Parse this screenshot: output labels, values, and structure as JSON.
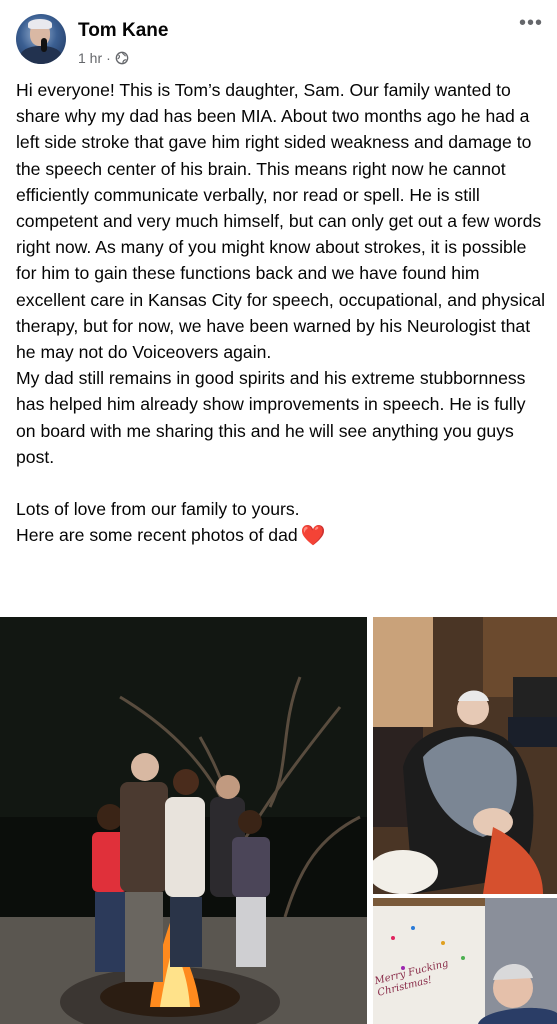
{
  "post": {
    "author": "Tom Kane",
    "timestamp": "1 hr",
    "separator": "·",
    "more_icon": "•••",
    "paragraphs": [
      "Hi everyone! This is Tom’s daughter, Sam. Our family wanted to share why my dad has been MIA. About two months ago he had a left side stroke that gave him right sided weakness and damage to the speech center of his brain. This means right now he cannot efficiently communicate verbally, nor read or spell. He is still competent and very much himself, but can only get out a few words right now. As many of you might know about strokes, it is possible for him to gain these functions back and we have found him excellent care in Kansas City for speech, occupational, and physical therapy, but for now, we have been warned by his Neurologist that he may not do Voiceovers again.",
      "My dad still remains in good spirits and his extreme stubbornness has helped him already show improvements in speech. He is fully on board with me sharing this and he will see anything you guys post.",
      "Lots of love from our family to yours.",
      "Here are some recent photos of dad"
    ],
    "heart_emoji": "❤️",
    "photo3_caption": "Merry Fucking Christmas!"
  },
  "icons": {
    "avatar": "profile-photo",
    "globe": "globe-icon",
    "more": "more-options-icon"
  },
  "colors": {
    "text": "#050505",
    "secondary_text": "#65676b",
    "heart": "#e0245e"
  }
}
